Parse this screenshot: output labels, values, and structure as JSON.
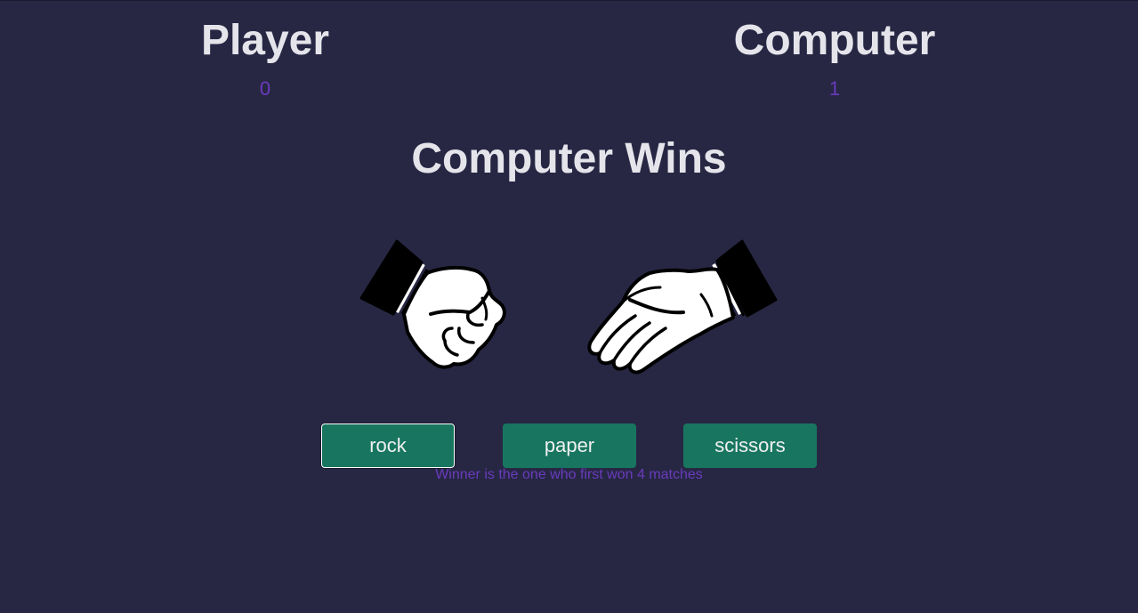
{
  "scoreboard": {
    "player": {
      "label": "Player",
      "score": "0"
    },
    "computer": {
      "label": "Computer",
      "score": "1"
    }
  },
  "result": "Computer Wins",
  "hands": {
    "player": {
      "choice": "rock",
      "icon": "fist-icon"
    },
    "computer": {
      "choice": "paper",
      "icon": "open-hand-icon"
    }
  },
  "buttons": [
    {
      "label": "rock"
    },
    {
      "label": "paper"
    },
    {
      "label": "scissors"
    }
  ],
  "hint": "Winner is the one who first won 4 matches",
  "colors": {
    "background": "#272744",
    "title": "#e4e4ea",
    "score": "#6a3bbd",
    "button": "#187660",
    "button_text": "#f0f0f0"
  }
}
